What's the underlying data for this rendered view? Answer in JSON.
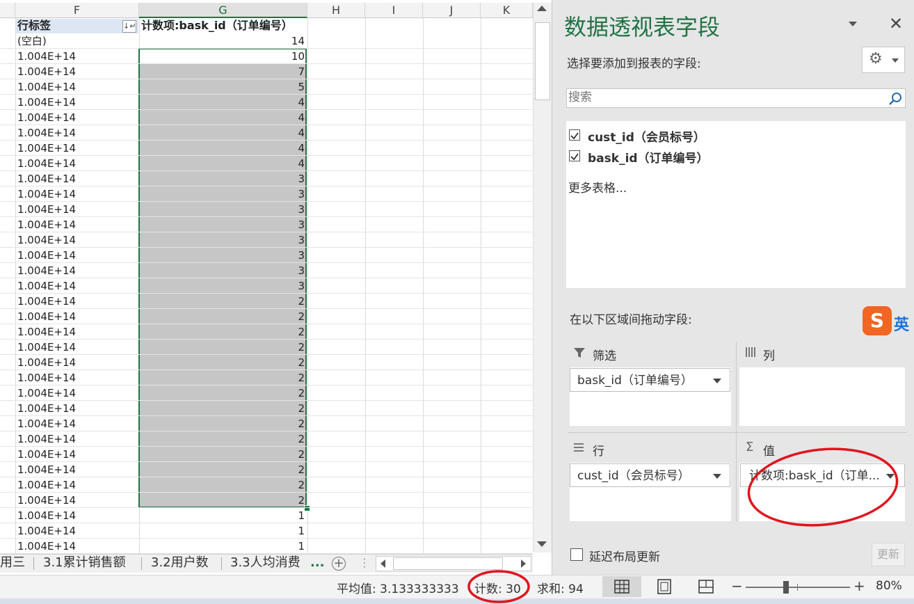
{
  "spreadsheet": {
    "columns": [
      "F",
      "G",
      "H",
      "I",
      "J",
      "K"
    ],
    "header_row_label": "行标签",
    "header_value_label": "计数项:bask_id（订单编号）",
    "rows": [
      {
        "label": "(空白)",
        "value": "14"
      },
      {
        "label": "1.004E+14",
        "value": "10"
      },
      {
        "label": "1.004E+14",
        "value": "7"
      },
      {
        "label": "1.004E+14",
        "value": "5"
      },
      {
        "label": "1.004E+14",
        "value": "4"
      },
      {
        "label": "1.004E+14",
        "value": "4"
      },
      {
        "label": "1.004E+14",
        "value": "4"
      },
      {
        "label": "1.004E+14",
        "value": "4"
      },
      {
        "label": "1.004E+14",
        "value": "4"
      },
      {
        "label": "1.004E+14",
        "value": "3"
      },
      {
        "label": "1.004E+14",
        "value": "3"
      },
      {
        "label": "1.004E+14",
        "value": "3"
      },
      {
        "label": "1.004E+14",
        "value": "3"
      },
      {
        "label": "1.004E+14",
        "value": "3"
      },
      {
        "label": "1.004E+14",
        "value": "3"
      },
      {
        "label": "1.004E+14",
        "value": "3"
      },
      {
        "label": "1.004E+14",
        "value": "3"
      },
      {
        "label": "1.004E+14",
        "value": "2"
      },
      {
        "label": "1.004E+14",
        "value": "2"
      },
      {
        "label": "1.004E+14",
        "value": "2"
      },
      {
        "label": "1.004E+14",
        "value": "2"
      },
      {
        "label": "1.004E+14",
        "value": "2"
      },
      {
        "label": "1.004E+14",
        "value": "2"
      },
      {
        "label": "1.004E+14",
        "value": "2"
      },
      {
        "label": "1.004E+14",
        "value": "2"
      },
      {
        "label": "1.004E+14",
        "value": "2"
      },
      {
        "label": "1.004E+14",
        "value": "2"
      },
      {
        "label": "1.004E+14",
        "value": "2"
      },
      {
        "label": "1.004E+14",
        "value": "2"
      },
      {
        "label": "1.004E+14",
        "value": "2"
      },
      {
        "label": "1.004E+14",
        "value": "2"
      },
      {
        "label": "1.004E+14",
        "value": "1"
      },
      {
        "label": "1.004E+14",
        "value": "1"
      },
      {
        "label": "1.004E+14",
        "value": "1"
      }
    ]
  },
  "sheet_tabs": [
    "用三",
    "3.1累计销售额",
    "3.2用户数",
    "3.3人均消费",
    "..."
  ],
  "status_bar": {
    "average": "平均值: 3.133333333",
    "count": "计数: 30",
    "sum": "求和: 94",
    "zoom_minus": "−",
    "zoom_plus": "+",
    "zoom": "80%",
    "zoom_level_percent": 80
  },
  "pivot_pane": {
    "title": "数据透视表字段",
    "choose_fields": "选择要添加到报表的字段:",
    "search_placeholder": "搜索",
    "fields": [
      {
        "label": "cust_id（会员标号）",
        "checked": true
      },
      {
        "label": "bask_id（订单编号）",
        "checked": true
      }
    ],
    "more_tables": "更多表格...",
    "drag_between": "在以下区域间拖动字段:",
    "ime_label": "英",
    "zones": {
      "filter": {
        "label": "筛选",
        "item": "bask_id（订单编号）"
      },
      "columns": {
        "label": "列"
      },
      "rows": {
        "label": "行",
        "item": "cust_id（会员标号）"
      },
      "values": {
        "label": "值",
        "item": "计数项:bask_id（订单..."
      }
    },
    "defer_update": "延迟布局更新",
    "update_button": "更新"
  },
  "colors": {
    "accent_green": "#217346",
    "selection_gray": "#c6c6c6",
    "annotation_red": "#e0141e"
  }
}
